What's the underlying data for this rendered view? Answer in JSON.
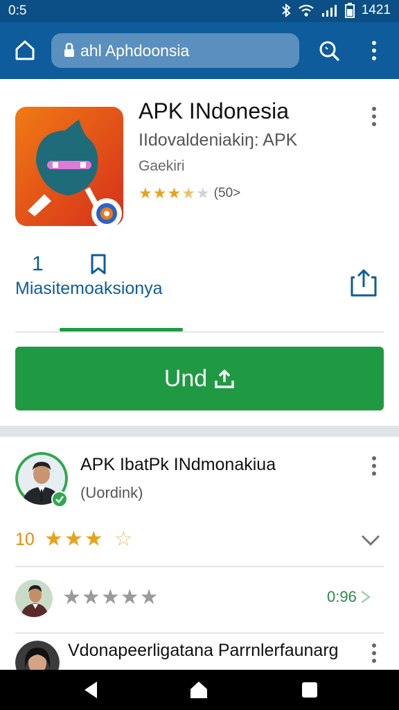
{
  "status": {
    "time": "0:5",
    "clock": "1421"
  },
  "browser": {
    "url": "ahl Aphdoonsia"
  },
  "app": {
    "title": "APK INdonesia",
    "developer": "IIdovaldeniakiŋ: APK",
    "category": "Gaekiri",
    "rating_count": "(50>",
    "rating": 3.5,
    "stat_number": "1",
    "stat_label": "Miasitemoaksionya",
    "install_label": "Und"
  },
  "reviews": [
    {
      "name": "APK IbatPk INdmonakiua",
      "subtitle": "(Uordink)",
      "score": "10",
      "stars": 3,
      "half_star_outline": true
    },
    {
      "score_label": "0:96",
      "stars": 5
    },
    {
      "name": "Vdonapeerligatana Parrnlerfaunarg"
    }
  ],
  "colors": {
    "primary": "#0e5c9b",
    "accent_green": "#1f9a43",
    "star_gold": "#e9a31a",
    "star_grey": "#9a9a9a"
  }
}
